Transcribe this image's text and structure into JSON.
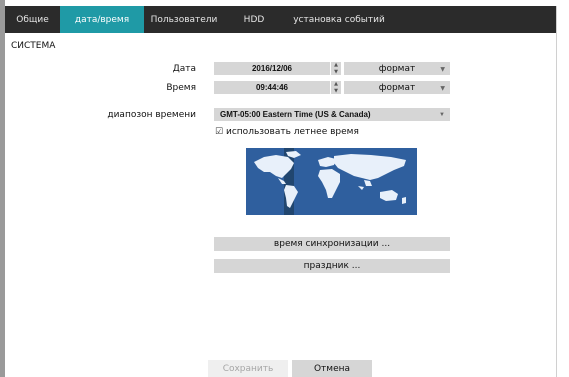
{
  "tabs": [
    {
      "label": "Общие"
    },
    {
      "label": "дата/время",
      "active": true
    },
    {
      "label": "Пользователи"
    },
    {
      "label": "HDD"
    },
    {
      "label": "установка событий"
    }
  ],
  "section_title": "СИСТЕМА",
  "date": {
    "label": "Дата",
    "value": "2016/12/06",
    "format": "формат"
  },
  "time": {
    "label": "Время",
    "value": "09:44:46",
    "format": "формат"
  },
  "timezone": {
    "label": "диапозон времени",
    "value": "GMT-05:00  Eastern Time (US & Canada)"
  },
  "dst": {
    "label": "использовать летнее время",
    "checked": true
  },
  "buttons": {
    "sync": "время синхронизации ...",
    "holiday": "праздник ...",
    "save": "Сохранить",
    "cancel": "Отмена"
  },
  "colors": {
    "accent": "#1f9aa6",
    "map_ocean": "#2f5f9e",
    "map_land": "#e8f0fa"
  }
}
